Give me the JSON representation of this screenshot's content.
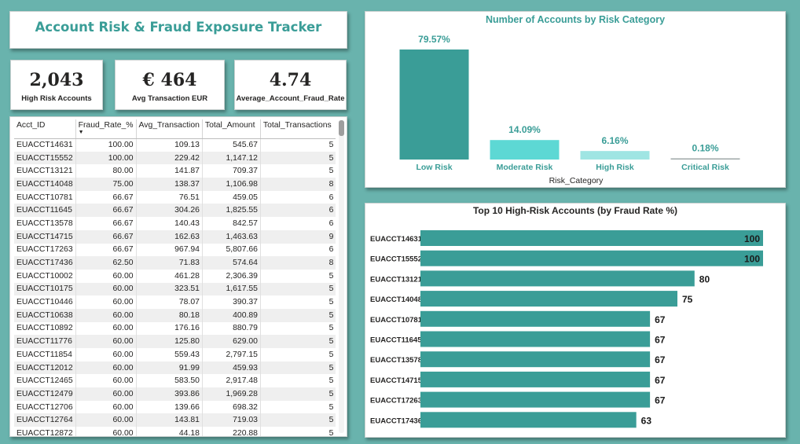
{
  "dashboard": {
    "title": "Account Risk & Fraud Exposure Tracker"
  },
  "kpis": [
    {
      "value": "2,043",
      "label": "High Risk Accounts"
    },
    {
      "value": "€ 464",
      "label": "Avg Transaction EUR"
    },
    {
      "value": "4.74",
      "label": "Average_Account_Fraud_Rate"
    }
  ],
  "table": {
    "headers": [
      "Acct_ID",
      "Fraud_Rate_%",
      "Avg_Transaction",
      "Total_Amount",
      "Total_Transactions"
    ],
    "rows": [
      [
        "EUACCT14631",
        "100.00",
        "109.13",
        "545.67",
        "5"
      ],
      [
        "EUACCT15552",
        "100.00",
        "229.42",
        "1,147.12",
        "5"
      ],
      [
        "EUACCT13121",
        "80.00",
        "141.87",
        "709.37",
        "5"
      ],
      [
        "EUACCT14048",
        "75.00",
        "138.37",
        "1,106.98",
        "8"
      ],
      [
        "EUACCT10781",
        "66.67",
        "76.51",
        "459.05",
        "6"
      ],
      [
        "EUACCT11645",
        "66.67",
        "304.26",
        "1,825.55",
        "6"
      ],
      [
        "EUACCT13578",
        "66.67",
        "140.43",
        "842.57",
        "6"
      ],
      [
        "EUACCT14715",
        "66.67",
        "162.63",
        "1,463.63",
        "9"
      ],
      [
        "EUACCT17263",
        "66.67",
        "967.94",
        "5,807.66",
        "6"
      ],
      [
        "EUACCT17436",
        "62.50",
        "71.83",
        "574.64",
        "8"
      ],
      [
        "EUACCT10002",
        "60.00",
        "461.28",
        "2,306.39",
        "5"
      ],
      [
        "EUACCT10175",
        "60.00",
        "323.51",
        "1,617.55",
        "5"
      ],
      [
        "EUACCT10446",
        "60.00",
        "78.07",
        "390.37",
        "5"
      ],
      [
        "EUACCT10638",
        "60.00",
        "80.18",
        "400.89",
        "5"
      ],
      [
        "EUACCT10892",
        "60.00",
        "176.16",
        "880.79",
        "5"
      ],
      [
        "EUACCT11776",
        "60.00",
        "125.80",
        "629.00",
        "5"
      ],
      [
        "EUACCT11854",
        "60.00",
        "559.43",
        "2,797.15",
        "5"
      ],
      [
        "EUACCT12012",
        "60.00",
        "91.99",
        "459.93",
        "5"
      ],
      [
        "EUACCT12465",
        "60.00",
        "583.50",
        "2,917.48",
        "5"
      ],
      [
        "EUACCT12479",
        "60.00",
        "393.86",
        "1,969.28",
        "5"
      ],
      [
        "EUACCT12706",
        "60.00",
        "139.66",
        "698.32",
        "5"
      ],
      [
        "EUACCT12764",
        "60.00",
        "143.81",
        "719.03",
        "5"
      ],
      [
        "EUACCT12872",
        "60.00",
        "44.18",
        "220.88",
        "5"
      ]
    ]
  },
  "colors": {
    "accent": "#3a9d97",
    "bar_primary": "#3a9d97"
  },
  "chart_data": [
    {
      "type": "bar",
      "title": "Number of Accounts by Risk Category",
      "xlabel": "Risk_Category",
      "ylabel": "",
      "categories": [
        "Low Risk",
        "Moderate Risk",
        "High Risk",
        "Critical Risk"
      ],
      "values": [
        79.57,
        14.09,
        6.16,
        0.18
      ],
      "data_labels": [
        "79.57%",
        "14.09%",
        "6.16%",
        "0.18%"
      ],
      "colors": [
        "#3a9d97",
        "#5dd8d4",
        "#9fe5e3",
        "#9fa7a7"
      ],
      "ylim": [
        0,
        79.57
      ],
      "grid": false
    },
    {
      "type": "bar",
      "orientation": "horizontal",
      "title": "Top 10 High-Risk Accounts (by Fraud Rate %)",
      "categories": [
        "EUACCT14631",
        "EUACCT15552",
        "EUACCT13121",
        "EUACCT14048",
        "EUACCT10781",
        "EUACCT11645",
        "EUACCT13578",
        "EUACCT14715",
        "EUACCT17263",
        "EUACCT17436"
      ],
      "values": [
        100,
        100,
        80,
        75,
        67,
        67,
        67,
        67,
        67,
        63
      ],
      "xlim": [
        0,
        100
      ],
      "grid": false
    }
  ]
}
